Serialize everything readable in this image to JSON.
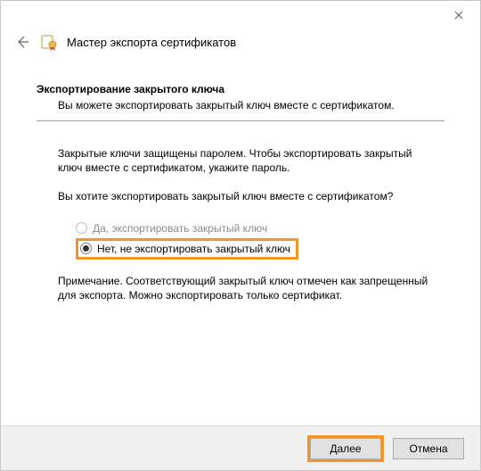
{
  "titlebar": {
    "close_label": "Close"
  },
  "header": {
    "wizard_title": "Мастер экспорта сертификатов"
  },
  "content": {
    "section_heading": "Экспортирование закрытого ключа",
    "section_sub": "Вы можете экспортировать закрытый ключ вместе с сертификатом.",
    "intro": "Закрытые ключи защищены паролем. Чтобы экспортировать закрытый ключ вместе с сертификатом, укажите пароль.",
    "question": "Вы хотите экспортировать закрытый ключ вместе с сертификатом?",
    "option_yes": "Да, экспортировать закрытый ключ",
    "option_no": "Нет, не экспортировать закрытый ключ",
    "note": "Примечание. Соответствующий закрытый ключ отмечен как запрещенный для экспорта. Можно экспортировать только сертификат."
  },
  "footer": {
    "next": "Далее",
    "cancel": "Отмена"
  }
}
